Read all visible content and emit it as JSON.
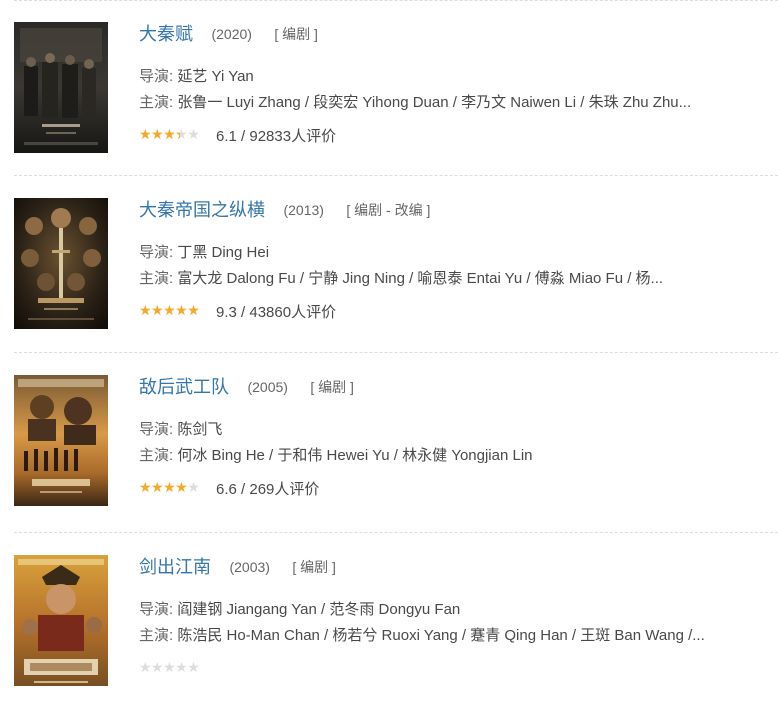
{
  "labels": {
    "director": "导演: ",
    "cast": "主演: ",
    "rating_sep": " / "
  },
  "colors": {
    "title_link": "#3377aa",
    "star_on": "#f8a828",
    "star_off": "#dddddd"
  },
  "items": [
    {
      "title": "大秦赋",
      "year": "(2020)",
      "role": "[ 编剧 ]",
      "director": "延艺 Yi Yan",
      "cast": "张鲁一 Luyi Zhang / 段奕宏 Yihong Duan / 李乃文 Naiwen Li / 朱珠 Zhu Zhu...",
      "score": "6.1",
      "votes": "92833人评价",
      "stars": 3,
      "poster_icon": "poster-da-qin-fu"
    },
    {
      "title": "大秦帝国之纵横",
      "year": "(2013)",
      "role": "[ 编剧 - 改编 ]",
      "director": "丁黑 Ding Hei",
      "cast": "富大龙 Dalong Fu / 宁静 Jing Ning / 喻恩泰 Entai Yu / 傅淼 Miao Fu / 杨...",
      "score": "9.3",
      "votes": "43860人评价",
      "stars": 5,
      "poster_icon": "poster-da-qin-di-guo"
    },
    {
      "title": "敌后武工队",
      "year": "(2005)",
      "role": "[ 编剧 ]",
      "director": "陈剑飞",
      "cast": "何冰 Bing He / 于和伟 Hewei Yu / 林永健 Yongjian Lin",
      "score": "6.6",
      "votes": "269人评价",
      "stars": 3.5,
      "poster_icon": "poster-di-hou-wu-gong-dui"
    },
    {
      "title": "剑出江南",
      "year": "(2003)",
      "role": "[ 编剧 ]",
      "director": "阎建钢 Jiangang Yan / 范冬雨 Dongyu Fan",
      "cast": "陈浩民 Ho-Man Chan / 杨若兮 Ruoxi Yang / 蹇青 Qing Han / 王斑 Ban Wang /...",
      "score": "",
      "votes": "",
      "stars": 0,
      "poster_icon": "poster-jian-chu-jiang-nan"
    }
  ]
}
